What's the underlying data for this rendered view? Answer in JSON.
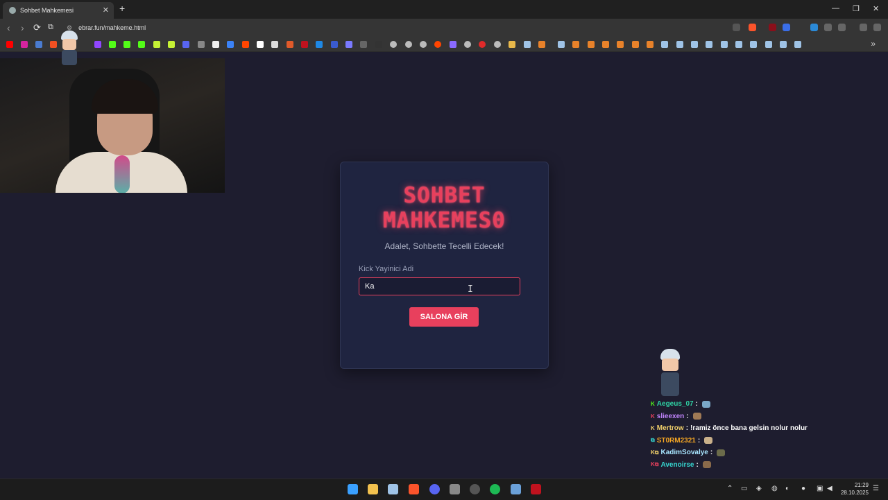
{
  "browser": {
    "tab_title": "Sohbet Mahkemesi",
    "tab_close": "✕",
    "new_tab": "+",
    "url": "ebrar.fun/mahkeme.html",
    "window": {
      "minimize": "—",
      "restore": "❐",
      "close": "✕"
    },
    "nav": {
      "back": "‹",
      "forward": "›",
      "reload": "⟳",
      "bookmark": "⧉"
    }
  },
  "card": {
    "title": "SOHBET MAHKEMES0",
    "subtitle": "Adalet, Sohbette Tecelli Edecek!",
    "field_label": "Kick Yayinici Adi",
    "input_value": "Ka",
    "button_label": "SALONA GİR"
  },
  "chat": [
    {
      "user": "Aegeus_07",
      "user_color": "#2fd3a5",
      "message": "",
      "emote_color": "#7aa7c7",
      "badge": "K",
      "badge_color": "#53fc18"
    },
    {
      "user": "slieexen",
      "user_color": "#c084fc",
      "message": "",
      "emote_color": "#a07a55",
      "badge": "K",
      "badge_color": "#e8405d"
    },
    {
      "user": "Mertrow",
      "user_color": "#f2d16b",
      "message": "!ramiz önce bana gelsin nolur nolur",
      "emote_color": "",
      "badge": "K",
      "badge_color": "#f2d16b"
    },
    {
      "user": "ST0RM2321",
      "user_color": "#f5a623",
      "message": "",
      "emote_color": "#c9b08a",
      "badge": "⧉",
      "badge_color": "#36d7d0"
    },
    {
      "user": "KadimSovalye",
      "user_color": "#a8e6ff",
      "message": "",
      "emote_color": "#6b6b4a",
      "badge": "K⧉",
      "badge_color": "#f2d16b"
    },
    {
      "user": "Avenoirse",
      "user_color": "#36d7d0",
      "message": "",
      "emote_color": "#8a6a4a",
      "badge": "K⧉",
      "badge_color": "#e8405d"
    }
  ],
  "taskbar": {
    "time": "21:29",
    "date": "28.10.2025"
  },
  "colors": {
    "accent": "#e8405d",
    "background": "#1e1d2f",
    "card": "#1f2440"
  }
}
